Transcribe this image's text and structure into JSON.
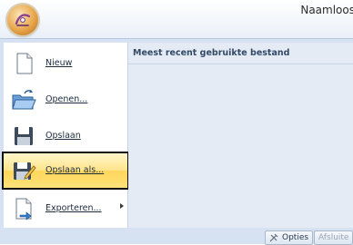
{
  "window": {
    "title": "Naamloos"
  },
  "menu": {
    "recent_header": "Meest recent gebruikte bestand",
    "items": [
      {
        "label": "Nieuw",
        "icon": "new-document-icon"
      },
      {
        "label": "Openen...",
        "icon": "open-folder-icon"
      },
      {
        "label": "Opslaan",
        "icon": "save-disk-icon"
      },
      {
        "label": "Opslaan als...",
        "icon": "save-as-icon",
        "highlighted": true
      },
      {
        "label": "Exporteren...",
        "icon": "export-icon",
        "has_submenu": true
      }
    ],
    "options_label": "Opties",
    "exit_label": "Afsluite"
  },
  "colors": {
    "highlight": "#ffe48a",
    "frame": "#d6e2f1",
    "recent_bg": "#e4ebf5"
  }
}
